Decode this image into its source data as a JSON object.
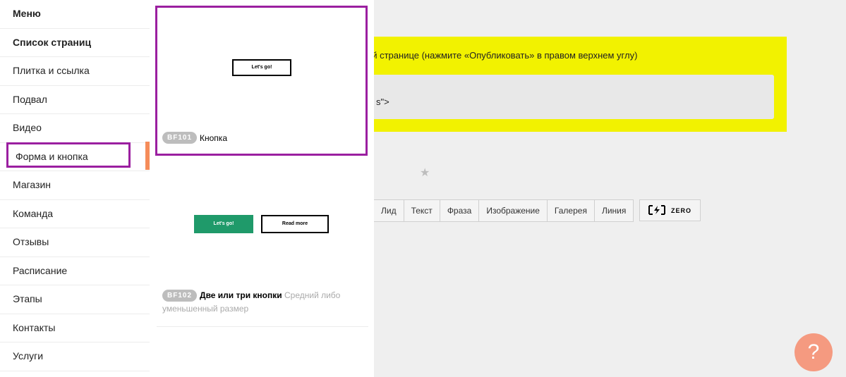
{
  "sidebar": {
    "items": [
      {
        "label": "Меню"
      },
      {
        "label": "Список страниц"
      },
      {
        "label": "Плитка и ссылка"
      },
      {
        "label": "Подвал"
      },
      {
        "label": "Видео"
      },
      {
        "label": "Форма и кнопка"
      },
      {
        "label": "Магазин"
      },
      {
        "label": "Команда"
      },
      {
        "label": "Отзывы"
      },
      {
        "label": "Расписание"
      },
      {
        "label": "Этапы"
      },
      {
        "label": "Контакты"
      },
      {
        "label": "Услуги"
      }
    ],
    "active_index": 5
  },
  "blocks": [
    {
      "code": "BF101",
      "title": "Кнопка",
      "preview": {
        "button_label": "Let's go!"
      }
    },
    {
      "code": "BF102",
      "title": "Две или три кнопки",
      "description": "Средний либо уменьшенный размер",
      "preview": {
        "primary_label": "Let's go!",
        "secondary_label": "Read more"
      }
    }
  ],
  "main": {
    "notice_text": "ой странице (нажмите «Опубликовать» в правом верхнем углу)",
    "code_snippet": "s\">",
    "toolbar": [
      "Лид",
      "Текст",
      "Фраза",
      "Изображение",
      "Галерея",
      "Линия"
    ],
    "zero_label": "ZERO",
    "help_label": "?"
  },
  "colors": {
    "highlight_outline": "#9b1fa0",
    "active_bar": "#f58c5a",
    "notice_bg": "#f2f200",
    "green_button": "#1f9a6a",
    "help_button": "#f59a80"
  }
}
